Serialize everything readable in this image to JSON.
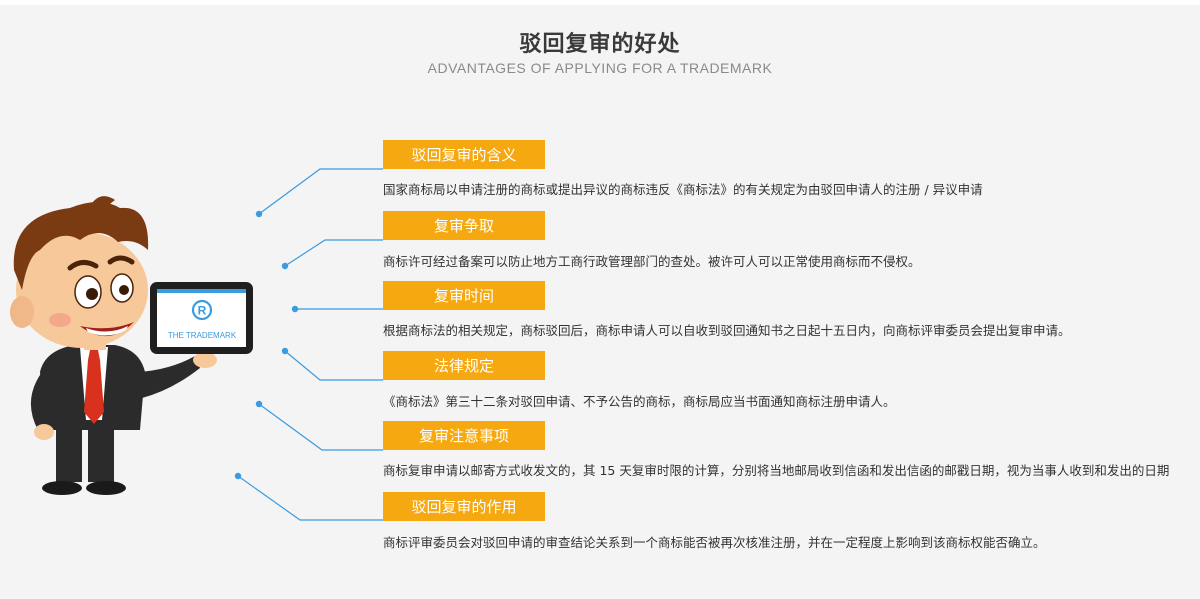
{
  "header": {
    "title": "驳回复审的好处",
    "subtitle": "ADVANTAGES OF APPLYING FOR A TRADEMARK"
  },
  "illustration": {
    "tablet_logo_letter": "R",
    "tablet_text": "THE TRADEMARK"
  },
  "colors": {
    "label_bg": "#f5a80f",
    "connector": "#3a9be0",
    "title_text": "#3a3a3a"
  },
  "items": [
    {
      "label": "驳回复审的含义",
      "desc": "国家商标局以申请注册的商标或提出异议的商标违反《商标法》的有关规定为由驳回申请人的注册 / 异议申请"
    },
    {
      "label": "复审争取",
      "desc": "商标许可经过备案可以防止地方工商行政管理部门的查处。被许可人可以正常使用商标而不侵权。"
    },
    {
      "label": "复审时间",
      "desc": "根据商标法的相关规定，商标驳回后，商标申请人可以自收到驳回通知书之日起十五日内，向商标评审委员会提出复审申请。"
    },
    {
      "label": "法律规定",
      "desc": "《商标法》第三十二条对驳回申请、不予公告的商标，商标局应当书面通知商标注册申请人。"
    },
    {
      "label": "复审注意事项",
      "desc": "商标复审申请以邮寄方式收发文的，其 15 天复审时限的计算，分别将当地邮局收到信函和发出信函的邮戳日期，视为当事人收到和发出的日期"
    },
    {
      "label": "驳回复审的作用",
      "desc": "商标评审委员会对驳回申请的审查结论关系到一个商标能否被再次核准注册，并在一定程度上影响到该商标权能否确立。"
    }
  ]
}
